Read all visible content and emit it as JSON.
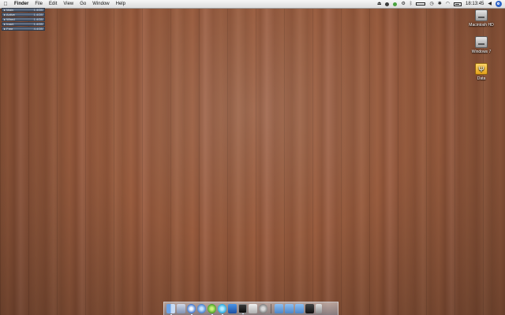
{
  "menubar": {
    "apple": "",
    "items": [
      "Finder",
      "File",
      "Edit",
      "View",
      "Go",
      "Window",
      "Help"
    ],
    "clock": "18:13:45"
  },
  "widget": {
    "rows": [
      {
        "k": "▸ Main",
        "v": "1.4GB"
      },
      {
        "k": "▸ Active",
        "v": "1.4GB"
      },
      {
        "k": "▸ Wired",
        "v": "1.4GB"
      },
      {
        "k": "▸ Inact.",
        "v": "1.4GB"
      },
      {
        "k": "▸ Free",
        "v": "4.4GB"
      }
    ]
  },
  "desktop": {
    "icons": [
      {
        "label": "Macintosh HD",
        "kind": "hard-drive-icon"
      },
      {
        "label": "Windows 7",
        "kind": "hard-drive-icon"
      },
      {
        "label": "Data",
        "kind": "usb-drive-icon"
      }
    ]
  },
  "dock": {
    "items": [
      "finder-icon",
      "mail-icon",
      "safari-icon",
      "itunes-icon",
      "green-app-icon",
      "skype-icon",
      "blue-app-icon",
      "terminal-icon",
      "dashboard-icon",
      "system-preferences-icon",
      "folder-icon",
      "folder-icon",
      "folder-icon",
      "dark-app-icon",
      "trash-icon"
    ]
  }
}
